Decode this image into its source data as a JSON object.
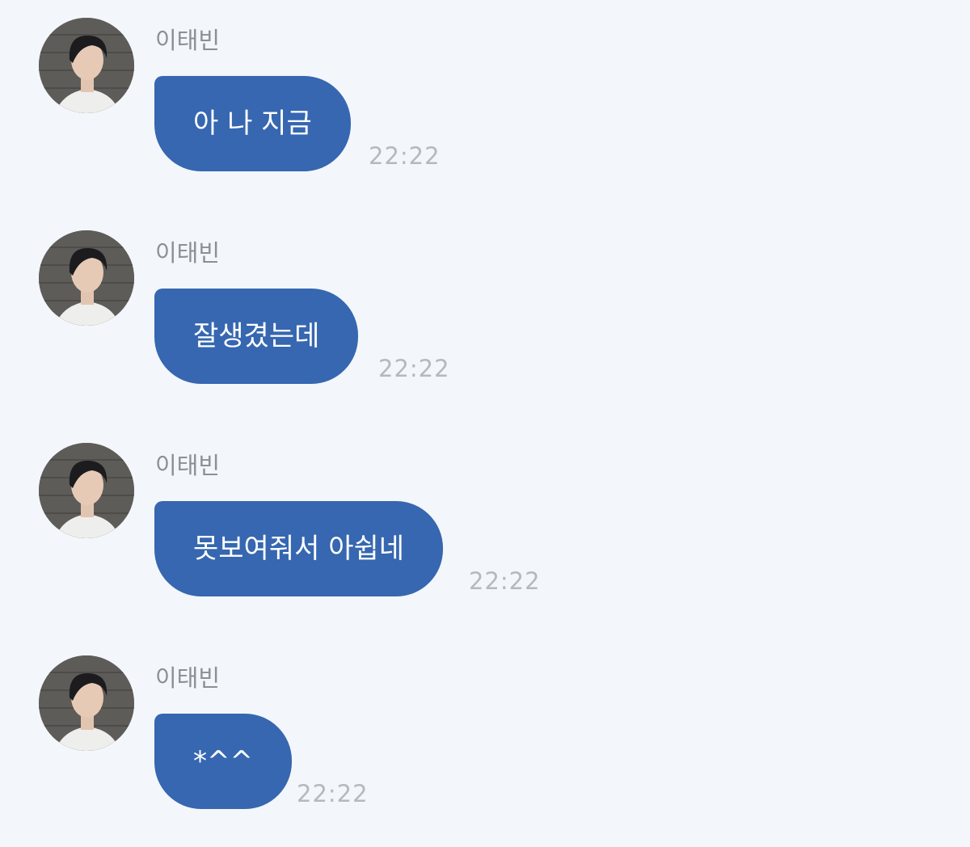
{
  "messages": [
    {
      "sender": "이태빈",
      "text": "아 나 지금",
      "time": "22:22"
    },
    {
      "sender": "이태빈",
      "text": "잘생겼는데",
      "time": "22:22"
    },
    {
      "sender": "이태빈",
      "text": "못보여줘서 아쉽네",
      "time": "22:22"
    },
    {
      "sender": "이태빈",
      "text": "*^^",
      "time": "22:22"
    }
  ],
  "colors": {
    "background": "#f3f6fa",
    "bubble": "#3667b0",
    "bubble_text": "#ffffff",
    "sender": "#8b8f96",
    "time": "#b4b9c0"
  },
  "icons": {
    "avatar": "profile-photo"
  }
}
